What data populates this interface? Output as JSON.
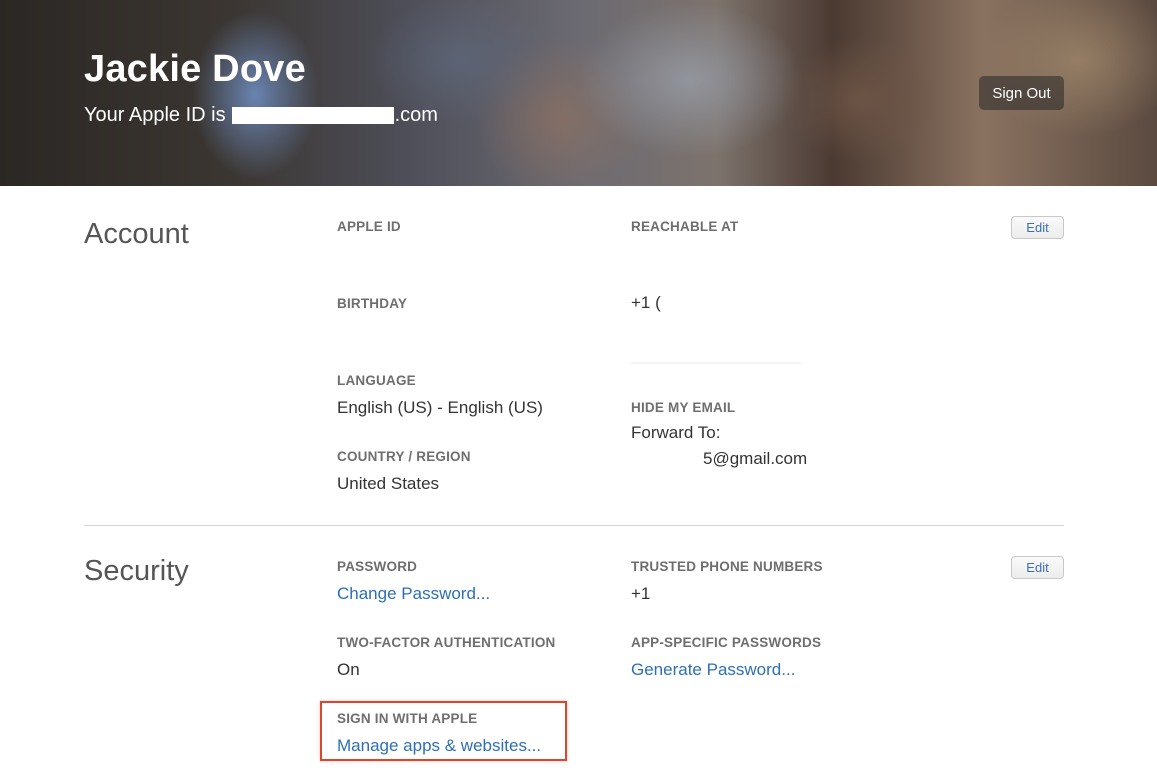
{
  "header": {
    "name": "Jackie Dove",
    "apple_id_prefix": "Your Apple ID is",
    "apple_id_suffix": ".com",
    "sign_out_label": "Sign Out"
  },
  "account": {
    "title": "Account",
    "edit_label": "Edit",
    "apple_id_label": "APPLE ID",
    "birthday_label": "BIRTHDAY",
    "language_label": "LANGUAGE",
    "language_value": "English (US) - English (US)",
    "country_label": "COUNTRY / REGION",
    "country_value": "United States",
    "reachable_label": "REACHABLE AT",
    "reachable_value": "+1 (",
    "hide_email_label": "HIDE MY EMAIL",
    "forward_to": "Forward To:",
    "forward_email_suffix": "5@gmail.com"
  },
  "security": {
    "title": "Security",
    "edit_label": "Edit",
    "password_label": "PASSWORD",
    "password_link": "Change Password...",
    "two_factor_label": "TWO-FACTOR AUTHENTICATION",
    "two_factor_value": "On",
    "sign_in_apple_label": "SIGN IN WITH APPLE",
    "sign_in_apple_link": "Manage apps & websites...",
    "trusted_label": "TRUSTED PHONE NUMBERS",
    "trusted_value": "+1",
    "app_passwords_label": "APP-SPECIFIC PASSWORDS",
    "app_passwords_link": "Generate Password..."
  },
  "colors": {
    "link": "#2d6fb5",
    "highlight": "#d9472e"
  }
}
